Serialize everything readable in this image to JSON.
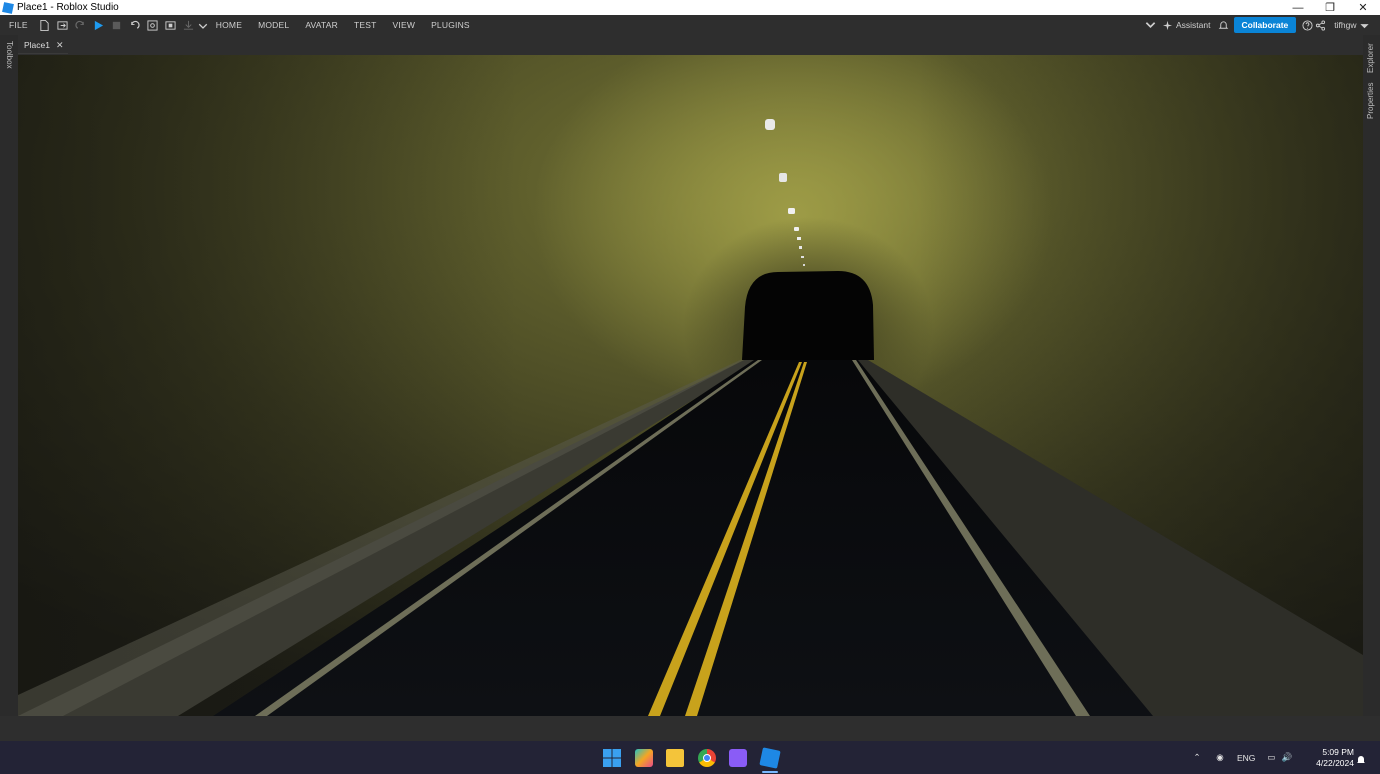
{
  "window": {
    "title": "Place1 - Roblox Studio"
  },
  "menubar": {
    "file_label": "FILE",
    "tabs": [
      "HOME",
      "MODEL",
      "AVATAR",
      "TEST",
      "VIEW",
      "PLUGINS"
    ],
    "assistant_label": "Assistant",
    "collaborate_label": "Collaborate",
    "user_label": "tifhgw"
  },
  "document_tab": {
    "label": "Place1",
    "close_glyph": "✕"
  },
  "side_panels": {
    "left": "Toolbox",
    "right_top": "Explorer",
    "right_bottom": "Properties"
  },
  "taskbar": {
    "apps": [
      "start-icon",
      "copilot-icon",
      "file-explorer-icon",
      "chrome-icon",
      "visual-studio-icon",
      "roblox-studio-icon"
    ],
    "language": "ENG",
    "time": "5:09 PM",
    "date": "4/22/2024"
  },
  "colors": {
    "accent": "#0a84d6",
    "road_line_yellow": "#c8a21c",
    "tunnel_wall": "#5a5a2a"
  }
}
